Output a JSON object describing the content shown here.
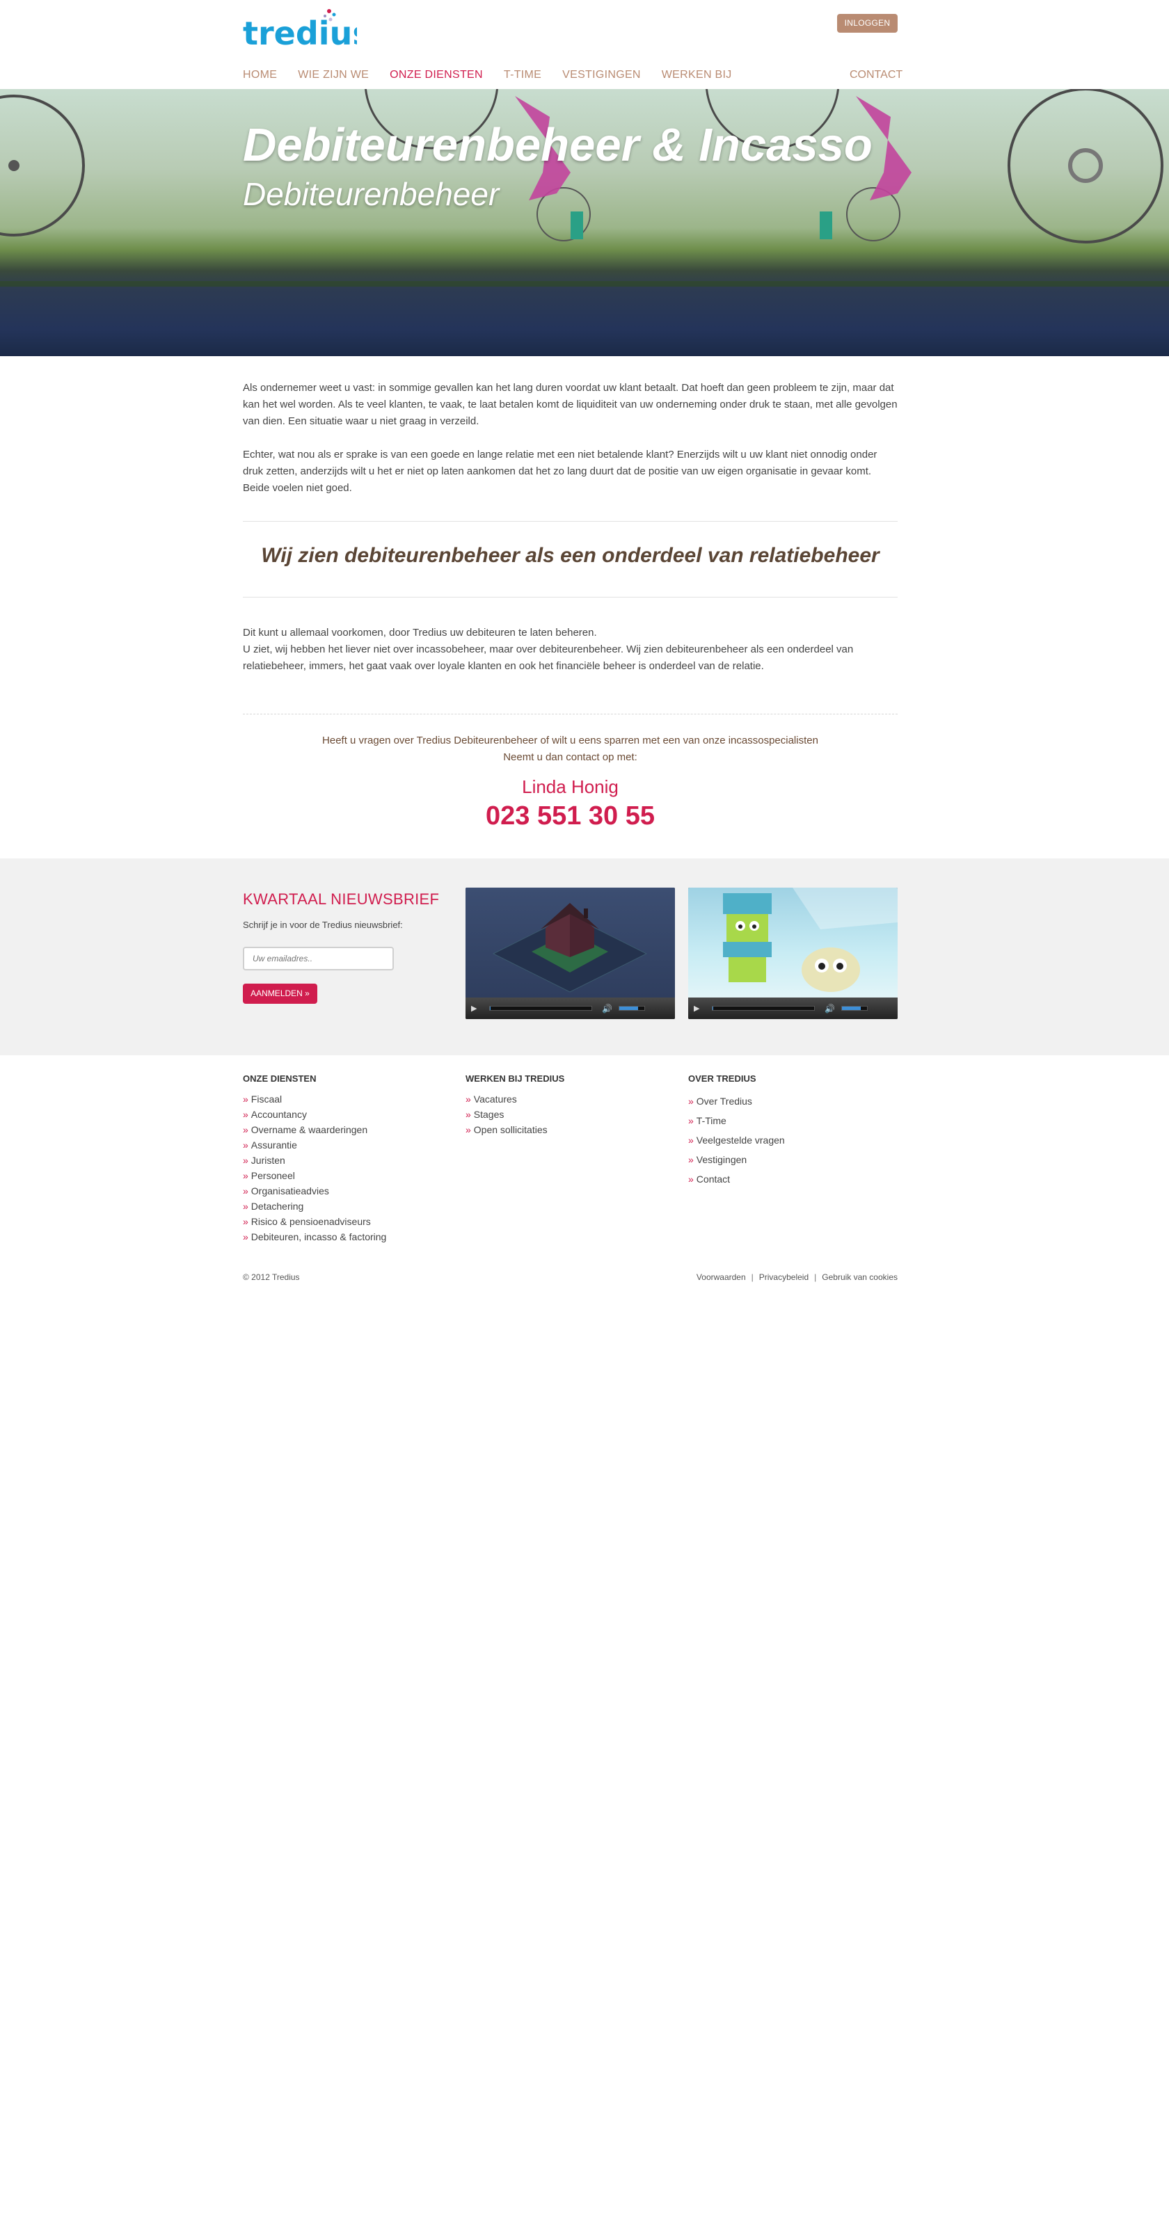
{
  "header": {
    "logo_text": "tredius",
    "login_label": "INLOGGEN",
    "nav": [
      "HOME",
      "WIE ZIJN WE",
      "ONZE DIENSTEN",
      "T-TIME",
      "VESTIGINGEN",
      "WERKEN BIJ"
    ],
    "active_nav": "ONZE DIENSTEN",
    "contact_label": "CONTACT"
  },
  "hero": {
    "title": "Debiteurenbeheer & Incasso",
    "subtitle": "Debiteurenbeheer"
  },
  "content": {
    "p1": "Als ondernemer weet u vast: in sommige gevallen kan het lang duren voordat uw klant betaalt. Dat hoeft dan geen probleem te zijn, maar dat kan het wel worden. Als te veel klanten, te vaak, te laat betalen komt de liquiditeit van uw onderneming onder druk te staan, met alle gevolgen van dien. Een situatie waar u niet graag in verzeild.",
    "p2": "Echter, wat nou als er sprake is van een goede en lange relatie met een niet betalende klant? Enerzijds wilt u uw klant niet onnodig onder druk zetten, anderzijds wilt u het er niet op laten aankomen dat het zo lang duurt dat de positie van uw eigen organisatie in gevaar komt. Beide voelen niet goed.",
    "quote": "Wij zien debiteurenbeheer als een onderdeel van relatiebeheer",
    "p3_line1": "Dit kunt u allemaal voorkomen, door Tredius uw debiteuren te laten beheren.",
    "p3_line2": "U ziet, wij hebben het liever niet over incassobeheer, maar over debiteurenbeheer. Wij zien debiteurenbeheer als een onderdeel van relatiebeheer, immers, het gaat vaak over loyale klanten en ook het financiële beheer is onderdeel van de relatie.",
    "contact_q1": "Heeft u vragen over Tredius Debiteurenbeheer of wilt u eens sparren met een van onze incassospecialisten",
    "contact_q2": "Neemt u dan contact op met:",
    "contact_name": "Linda Honig",
    "contact_phone": "023 551 30 55"
  },
  "newsletter": {
    "title": "KWARTAAL NIEUWSBRIEF",
    "text": "Schrijf je in voor de Tredius nieuwsbrief:",
    "placeholder": "Uw emailadres..",
    "button": "AANMELDEN »"
  },
  "videos": [
    {
      "progress": 0.01,
      "volume": 0.75
    },
    {
      "progress": 0.01,
      "volume": 0.75
    }
  ],
  "footer": {
    "col1": {
      "title": "ONZE DIENSTEN",
      "links": [
        "Fiscaal",
        "Accountancy",
        "Overname & waarderingen",
        "Assurantie",
        "Juristen",
        "Personeel",
        "Organisatieadvies",
        "Detachering",
        "Risico & pensioenadviseurs",
        "Debiteuren, incasso & factoring"
      ]
    },
    "col2": {
      "title": "WERKEN BIJ TREDIUS",
      "links": [
        "Vacatures",
        "Stages",
        "Open sollicitaties"
      ]
    },
    "col3": {
      "title": "OVER TREDIUS",
      "links": [
        "Over Tredius",
        "T-Time",
        "Veelgestelde vragen",
        "Vestigingen",
        "Contact"
      ]
    },
    "copyright": "© 2012 Tredius",
    "legal": [
      "Voorwaarden",
      "Privacybeleid",
      "Gebruik van cookies"
    ]
  },
  "colors": {
    "accent": "#d01d4e",
    "brand_brown": "#b98b72",
    "logo_blue": "#1aa0d8"
  }
}
